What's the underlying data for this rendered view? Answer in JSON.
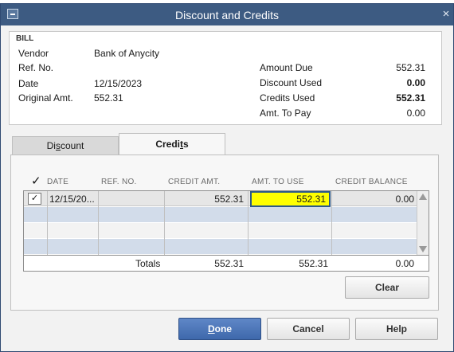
{
  "window": {
    "title": "Discount and Credits",
    "close_glyph": "×"
  },
  "bill": {
    "header": "BILL",
    "vendor_label": "Vendor",
    "vendor": "Bank of Anycity",
    "ref_label": "Ref. No.",
    "ref": "",
    "date_label": "Date",
    "date": "12/15/2023",
    "orig_label": "Original Amt.",
    "orig": "552.31",
    "amount_due_label": "Amount Due",
    "amount_due": "552.31",
    "discount_used_label": "Discount Used",
    "discount_used": "0.00",
    "credits_used_label": "Credits Used",
    "credits_used": "552.31",
    "amt_to_pay_label": "Amt. To Pay",
    "amt_to_pay": "0.00"
  },
  "tabs": {
    "discount_pre": "Di",
    "discount_u": "s",
    "discount_post": "count",
    "credits_pre": "Credi",
    "credits_u": "t",
    "credits_post": "s"
  },
  "grid": {
    "check_header": "✓",
    "headers": {
      "date": "DATE",
      "ref": "REF. NO.",
      "credit_amt": "CREDIT AMT.",
      "amt_to_use": "AMT. TO USE",
      "credit_balance": "CREDIT BALANCE"
    },
    "rows": [
      {
        "checked": "✓",
        "date": "12/15/20...",
        "ref": "",
        "credit_amt": "552.31",
        "amt_to_use": "552.31",
        "credit_balance": "0.00"
      }
    ],
    "totals_label": "Totals",
    "totals": {
      "credit_amt": "552.31",
      "amt_to_use": "552.31",
      "credit_balance": "0.00"
    }
  },
  "buttons": {
    "clear": "Clear",
    "done_u": "D",
    "done_rest": "one",
    "cancel": "Cancel",
    "help": "Help"
  },
  "colors": {
    "titlebar": "#3d5b82",
    "highlight": "#ffff00",
    "primary_button": "#3e68ab"
  }
}
